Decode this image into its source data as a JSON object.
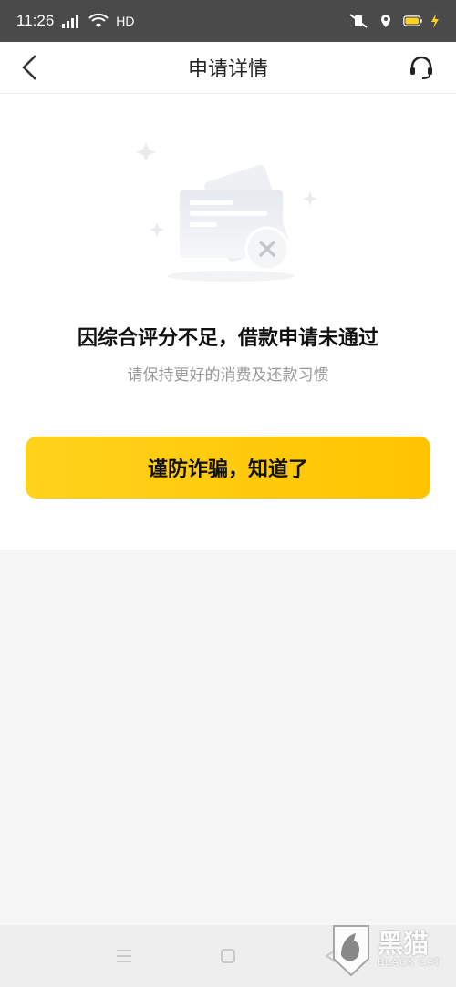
{
  "status_bar": {
    "time": "11:26",
    "network": "4G",
    "hd": "HD"
  },
  "header": {
    "title": "申请详情",
    "back_icon": "chevron-left-icon",
    "support_icon": "headset-icon"
  },
  "result": {
    "illustration_icon": "rejected-card-icon",
    "main_message": "因综合评分不足，借款申请未通过",
    "sub_message": "请保持更好的消费及还款习惯"
  },
  "actions": {
    "ack_label": "谨防诈骗，知道了"
  },
  "nav_bar": {
    "menu_icon": "menu-icon",
    "home_icon": "home-square-icon",
    "back_icon": "back-triangle-icon"
  },
  "watermark": {
    "cn": "黑猫",
    "en": "BLACK CAT"
  },
  "colors": {
    "accent": "#ffc400",
    "status_bar": "#4a4a4a"
  }
}
